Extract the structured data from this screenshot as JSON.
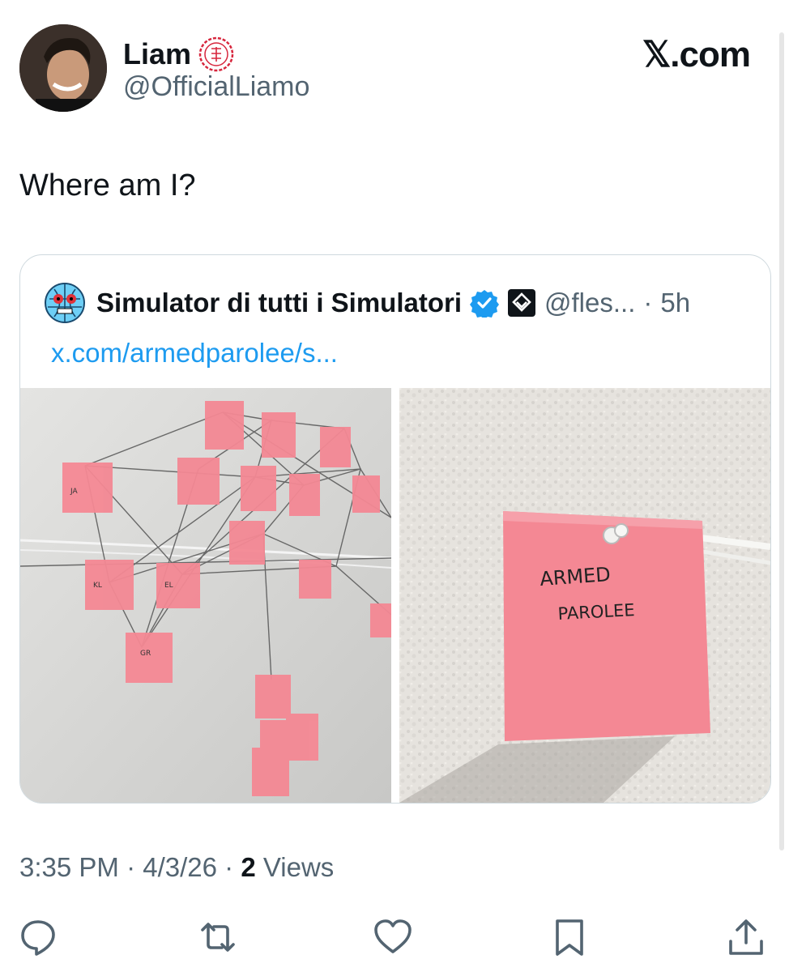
{
  "author": {
    "name": "Liam",
    "handle": "@OfficialLiamo",
    "avatar_icon": "profile-photo",
    "affiliation_icon": "red-seal-icon"
  },
  "brand": "𝕏.com",
  "tweet": {
    "text": "Where am I?"
  },
  "quoted": {
    "name": "Simulator di tutti i Simulatori",
    "handle": "@fles...",
    "time": "5h",
    "link": "x.com/armedparolee/s...",
    "verified_color": "#1d9bf0",
    "note_text": [
      "ARMED",
      "PAROLEE"
    ]
  },
  "meta": {
    "time": "3:35 PM",
    "date": "4/3/26",
    "views_count": "2",
    "views_label": "Views"
  },
  "actions": [
    {
      "name": "reply-icon"
    },
    {
      "name": "retweet-icon"
    },
    {
      "name": "like-icon"
    },
    {
      "name": "bookmark-icon"
    },
    {
      "name": "share-icon"
    }
  ],
  "colors": {
    "accent": "#1d9bf0",
    "text": "#0f1419",
    "muted": "#536471",
    "note": "#f48894"
  }
}
